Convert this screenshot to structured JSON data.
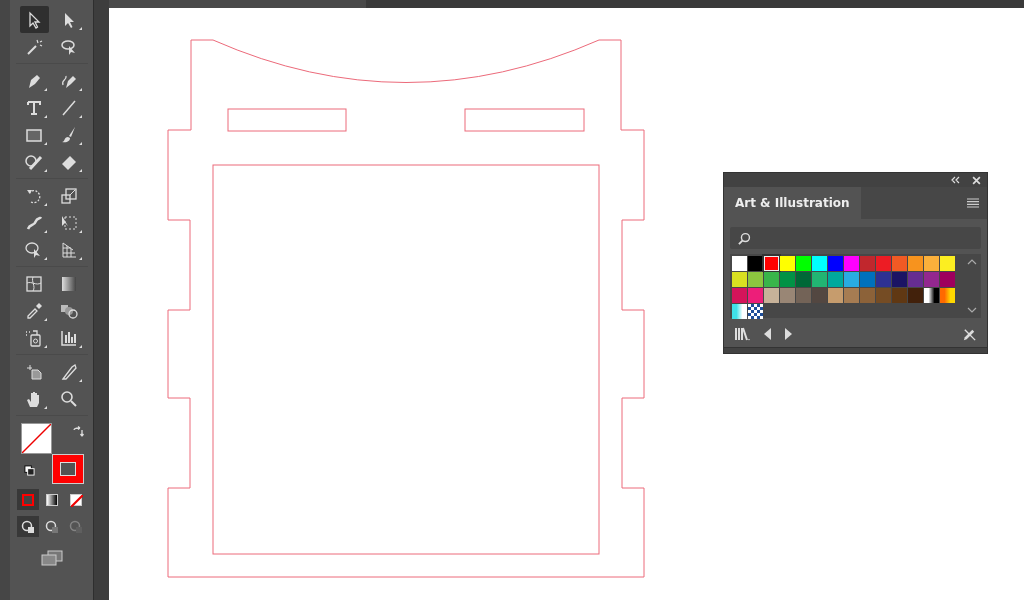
{
  "toolbar": {
    "groups": [
      [
        [
          {
            "kind": "select",
            "selected": true
          },
          {
            "kind": "direct",
            "selected": false
          }
        ],
        [
          {
            "kind": "magic",
            "selected": false
          },
          {
            "kind": "lasso",
            "selected": false
          }
        ]
      ],
      [
        [
          {
            "kind": "pen",
            "selected": false
          },
          {
            "kind": "curvature",
            "selected": false
          }
        ],
        [
          {
            "kind": "type",
            "selected": false
          },
          {
            "kind": "line",
            "selected": false
          }
        ],
        [
          {
            "kind": "rect",
            "selected": false
          },
          {
            "kind": "brush",
            "selected": false
          }
        ],
        [
          {
            "kind": "shaper",
            "selected": false
          },
          {
            "kind": "eraser",
            "selected": false
          }
        ]
      ],
      [
        [
          {
            "kind": "rotate",
            "selected": false
          },
          {
            "kind": "scale",
            "selected": false
          }
        ],
        [
          {
            "kind": "warp",
            "selected": false
          },
          {
            "kind": "transform",
            "selected": false
          }
        ],
        [
          {
            "kind": "builder",
            "selected": false
          },
          {
            "kind": "perspective",
            "selected": false
          }
        ]
      ],
      [
        [
          {
            "kind": "mesh",
            "selected": false
          },
          {
            "kind": "gradient",
            "selected": false
          }
        ],
        [
          {
            "kind": "eyedropper",
            "selected": false
          },
          {
            "kind": "blend",
            "selected": false
          }
        ],
        [
          {
            "kind": "sprayer",
            "selected": false
          },
          {
            "kind": "graph",
            "selected": false
          }
        ]
      ],
      [
        [
          {
            "kind": "artboard",
            "selected": false
          },
          {
            "kind": "slice",
            "selected": false
          }
        ],
        [
          {
            "kind": "hand",
            "selected": false
          },
          {
            "kind": "zoom",
            "selected": false
          }
        ]
      ]
    ],
    "fill": {
      "kind": "none"
    },
    "stroke": {
      "kind": "solid",
      "color": "#ff0000"
    },
    "color_modes": [
      {
        "kind": "color",
        "selected": true
      },
      {
        "kind": "gradient",
        "selected": false
      },
      {
        "kind": "none",
        "selected": false
      }
    ],
    "draw_modes": [
      {
        "kind": "normal",
        "selected": true,
        "disabled": false
      },
      {
        "kind": "behind",
        "selected": false,
        "disabled": false
      },
      {
        "kind": "inside",
        "selected": false,
        "disabled": true
      }
    ]
  },
  "panel": {
    "title": "Art & Illustration",
    "swatches": [
      {
        "kind": "solid",
        "color": "#ffffff",
        "selected": false
      },
      {
        "kind": "solid",
        "color": "#000000",
        "selected": false
      },
      {
        "kind": "solid",
        "color": "#ff0000",
        "selected": true
      },
      {
        "kind": "solid",
        "color": "#ffff00",
        "selected": false
      },
      {
        "kind": "solid",
        "color": "#00ff00",
        "selected": false
      },
      {
        "kind": "solid",
        "color": "#00ffff",
        "selected": false
      },
      {
        "kind": "solid",
        "color": "#0000ff",
        "selected": false
      },
      {
        "kind": "solid",
        "color": "#ff00ff",
        "selected": false
      },
      {
        "kind": "solid",
        "color": "#c1272d",
        "selected": false
      },
      {
        "kind": "solid",
        "color": "#ed1c24",
        "selected": false
      },
      {
        "kind": "solid",
        "color": "#f15a24",
        "selected": false
      },
      {
        "kind": "solid",
        "color": "#f7931e",
        "selected": false
      },
      {
        "kind": "solid",
        "color": "#fbb03b",
        "selected": false
      },
      {
        "kind": "solid",
        "color": "#fcee21",
        "selected": false
      },
      {
        "kind": "solid",
        "color": "#d9e021",
        "selected": false
      },
      {
        "kind": "solid",
        "color": "#8cc63f",
        "selected": false
      },
      {
        "kind": "solid",
        "color": "#39b54a",
        "selected": false
      },
      {
        "kind": "solid",
        "color": "#009245",
        "selected": false
      },
      {
        "kind": "solid",
        "color": "#006837",
        "selected": false
      },
      {
        "kind": "solid",
        "color": "#22b573",
        "selected": false
      },
      {
        "kind": "solid",
        "color": "#00a99d",
        "selected": false
      },
      {
        "kind": "solid",
        "color": "#29abe2",
        "selected": false
      },
      {
        "kind": "solid",
        "color": "#0071bc",
        "selected": false
      },
      {
        "kind": "solid",
        "color": "#2e3192",
        "selected": false
      },
      {
        "kind": "solid",
        "color": "#1b1464",
        "selected": false
      },
      {
        "kind": "solid",
        "color": "#662d91",
        "selected": false
      },
      {
        "kind": "solid",
        "color": "#93278f",
        "selected": false
      },
      {
        "kind": "solid",
        "color": "#9e005d",
        "selected": false
      },
      {
        "kind": "solid",
        "color": "#d4145a",
        "selected": false
      },
      {
        "kind": "solid",
        "color": "#ed1e79",
        "selected": false
      },
      {
        "kind": "solid",
        "color": "#c7b299",
        "selected": false
      },
      {
        "kind": "solid",
        "color": "#998675",
        "selected": false
      },
      {
        "kind": "solid",
        "color": "#736357",
        "selected": false
      },
      {
        "kind": "solid",
        "color": "#534741",
        "selected": false
      },
      {
        "kind": "solid",
        "color": "#c69c6d",
        "selected": false
      },
      {
        "kind": "solid",
        "color": "#a67c52",
        "selected": false
      },
      {
        "kind": "solid",
        "color": "#8c6239",
        "selected": false
      },
      {
        "kind": "solid",
        "color": "#754c24",
        "selected": false
      },
      {
        "kind": "solid",
        "color": "#603813",
        "selected": false
      },
      {
        "kind": "solid",
        "color": "#42210b",
        "selected": false
      },
      {
        "kind": "gradient",
        "stops": [
          {
            "color": "#ffffff"
          },
          {
            "color": "#000000"
          }
        ],
        "selected": false
      },
      {
        "kind": "gradient",
        "stops": [
          {
            "color": "#ff6a00"
          },
          {
            "color": "#ffd800"
          }
        ],
        "selected": false
      },
      {
        "kind": "gradient",
        "stops": [
          {
            "color": "#3fe0e8"
          },
          {
            "color": "#ffffff"
          }
        ],
        "selected": false
      },
      {
        "kind": "pattern",
        "stops": [
          {
            "color": "#1f4f9a"
          },
          {
            "color": "#ffffff"
          }
        ],
        "selected": false
      }
    ]
  }
}
